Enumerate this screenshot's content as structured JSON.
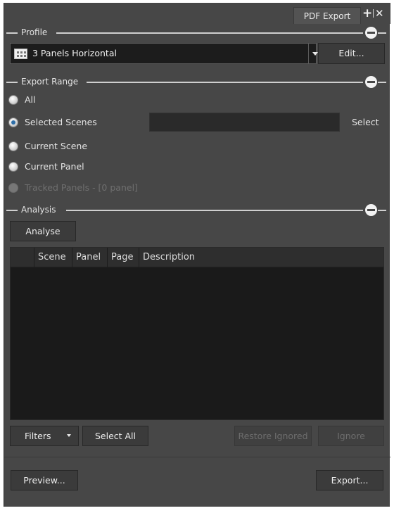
{
  "tab": {
    "title": "PDF Export",
    "plus_icon": "plus-icon",
    "close_icon": "close-icon"
  },
  "profile": {
    "section_label": "Profile",
    "selected": "3 Panels Horizontal",
    "icon": "panels-grid-icon",
    "edit_label": "Edit..."
  },
  "export_range": {
    "section_label": "Export Range",
    "options": [
      {
        "label": "All",
        "checked": false,
        "enabled": true
      },
      {
        "label": "Selected Scenes",
        "checked": true,
        "enabled": true
      },
      {
        "label": "Current Scene",
        "checked": false,
        "enabled": true
      },
      {
        "label": "Current Panel",
        "checked": false,
        "enabled": true
      },
      {
        "label": "Tracked Panels - [0 panel]",
        "checked": false,
        "enabled": false
      }
    ],
    "scene_field_value": "",
    "select_label": "Select"
  },
  "analysis": {
    "section_label": "Analysis",
    "analyse_label": "Analyse",
    "columns": [
      "",
      "Scene",
      "Panel",
      "Page",
      "Description"
    ],
    "rows": []
  },
  "buttons": {
    "filters": "Filters",
    "select_all": "Select All",
    "restore_ignored": "Restore Ignored",
    "ignore": "Ignore",
    "preview": "Preview...",
    "export": "Export..."
  },
  "colors": {
    "panel_bg": "#474747",
    "field_bg": "#1c1c1c",
    "radio_checked": "#2d6ea8"
  }
}
